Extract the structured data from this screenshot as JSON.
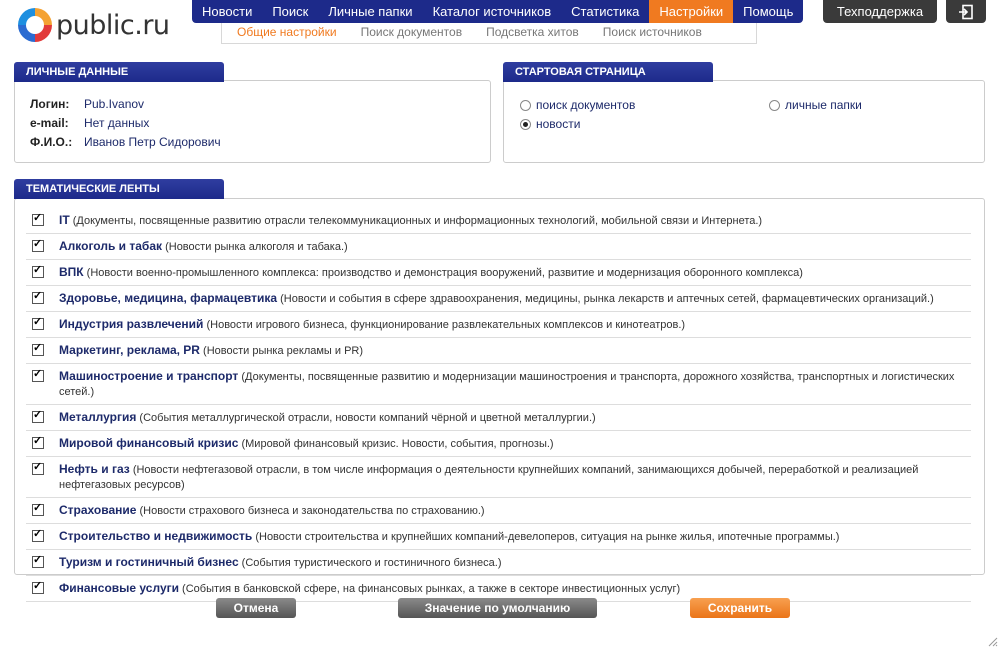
{
  "logo": {
    "text": "public.ru"
  },
  "nav": {
    "items": [
      {
        "label": "Новости",
        "active": false
      },
      {
        "label": "Поиск",
        "active": false
      },
      {
        "label": "Личные папки",
        "active": false
      },
      {
        "label": "Каталог источников",
        "active": false
      },
      {
        "label": "Статистика",
        "active": false
      },
      {
        "label": "Настройки",
        "active": true
      },
      {
        "label": "Помощь",
        "active": false
      }
    ],
    "support": "Техподдержка",
    "exit_icon": "exit-icon"
  },
  "subnav": {
    "items": [
      {
        "label": "Общие настройки",
        "active": true
      },
      {
        "label": "Поиск документов",
        "active": false
      },
      {
        "label": "Подсветка хитов",
        "active": false
      },
      {
        "label": "Поиск источников",
        "active": false
      }
    ]
  },
  "personal": {
    "title": "ЛИЧНЫЕ ДАННЫЕ",
    "login_label": "Логин:",
    "login_value": "Pub.Ivanov",
    "email_label": "e-mail:",
    "email_value": "Нет данных",
    "fio_label": "Ф.И.О.:",
    "fio_value": "Иванов Петр Сидорович"
  },
  "start_page": {
    "title": "СТАРТОВАЯ СТРАНИЦА",
    "options": [
      {
        "label": "поиск документов",
        "checked": false
      },
      {
        "label": "новости",
        "checked": true
      },
      {
        "label": "личные папки",
        "checked": false
      }
    ]
  },
  "feeds": {
    "title": "ТЕМАТИЧЕСКИЕ ЛЕНТЫ",
    "items": [
      {
        "name": "IT",
        "desc": " (Документы, посвященные развитию отрасли телекоммуникационных и информационных технологий, мобильной связи и Интернета.)",
        "checked": true
      },
      {
        "name": "Алкоголь и табак",
        "desc": " (Новости рынка алкоголя и табака.)",
        "checked": true
      },
      {
        "name": "ВПК",
        "desc": " (Новости военно-промышленного комплекса: производство и демонстрация вооружений, развитие и модернизация оборонного комплекса)",
        "checked": true
      },
      {
        "name": "Здоровье, медицина, фармацевтика",
        "desc": " (Новости и события в сфере здравоохранения, медицины, рынка лекарств и аптечных сетей, фармацевтических организаций.)",
        "checked": true
      },
      {
        "name": "Индустрия развлечений",
        "desc": " (Новости игрового бизнеса, функционирование развлекательных комплексов и кинотеатров.)",
        "checked": true
      },
      {
        "name": "Маркетинг, реклама, PR",
        "desc": " (Новости рынка рекламы и PR)",
        "checked": true
      },
      {
        "name": "Машиностроение и транспорт",
        "desc": " (Документы, посвященные развитию и модернизации машиностроения и транспорта, дорожного хозяйства, транспортных и логистических сетей.)",
        "checked": true
      },
      {
        "name": "Металлургия",
        "desc": " (События металлургической отрасли, новости компаний чёрной и цветной металлургии.)",
        "checked": true
      },
      {
        "name": "Мировой финансовый кризис",
        "desc": " (Мировой финансовый кризис. Новости, события, прогнозы.)",
        "checked": true
      },
      {
        "name": "Нефть и газ",
        "desc": " (Новости нефтегазовой отрасли, в том числе информация о деятельности крупнейших компаний, занимающихся добычей, переработкой и реализацией нефтегазовых ресурсов)",
        "checked": true
      },
      {
        "name": "Страхование",
        "desc": " (Новости страхового бизнеса и законодательства по страхованию.)",
        "checked": true
      },
      {
        "name": "Строительство и недвижимость",
        "desc": " (Новости строительства и крупнейших компаний-девелоперов, ситуация на рынке жилья, ипотечные программы.)",
        "checked": true
      },
      {
        "name": "Туризм и гостиничный бизнес",
        "desc": " (События туристического и гостиничного бизнеса.)",
        "checked": true
      },
      {
        "name": "Финансовые услуги",
        "desc": " (События в банковской сфере, на финансовых рынках, а также в секторе инвестиционных услуг)",
        "checked": true
      }
    ]
  },
  "buttons": {
    "cancel": "Отмена",
    "default": "Значение по умолчанию",
    "save": "Сохранить"
  },
  "colors": {
    "nav_bg": "#1d2a8a",
    "accent": "#f07a20",
    "support_bg": "#3a3a3a"
  }
}
